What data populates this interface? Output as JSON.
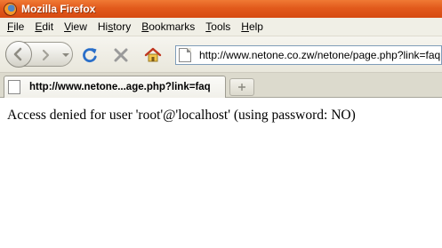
{
  "window": {
    "title": "Mozilla Firefox"
  },
  "menubar": {
    "items": [
      {
        "pre": "",
        "accel": "F",
        "post": "ile"
      },
      {
        "pre": "",
        "accel": "E",
        "post": "dit"
      },
      {
        "pre": "",
        "accel": "V",
        "post": "iew"
      },
      {
        "pre": "Hi",
        "accel": "s",
        "post": "tory"
      },
      {
        "pre": "",
        "accel": "B",
        "post": "ookmarks"
      },
      {
        "pre": "",
        "accel": "T",
        "post": "ools"
      },
      {
        "pre": "",
        "accel": "H",
        "post": "elp"
      }
    ]
  },
  "navbar": {
    "url": "http://www.netone.co.zw/netone/page.php?link=faq"
  },
  "tabs": [
    {
      "title": "http://www.netone...age.php?link=faq"
    }
  ],
  "content": {
    "message": "Access denied for user 'root'@'localhost' (using password: NO)"
  },
  "colors": {
    "titlebar": "#e25a1c",
    "reload": "#2a6fc9",
    "stop": "#9a9a9a"
  },
  "icons": [
    "firefox-icon",
    "back-arrow-icon",
    "forward-arrow-icon",
    "dropdown-icon",
    "reload-icon",
    "stop-icon",
    "home-icon",
    "page-icon",
    "new-tab-icon"
  ]
}
